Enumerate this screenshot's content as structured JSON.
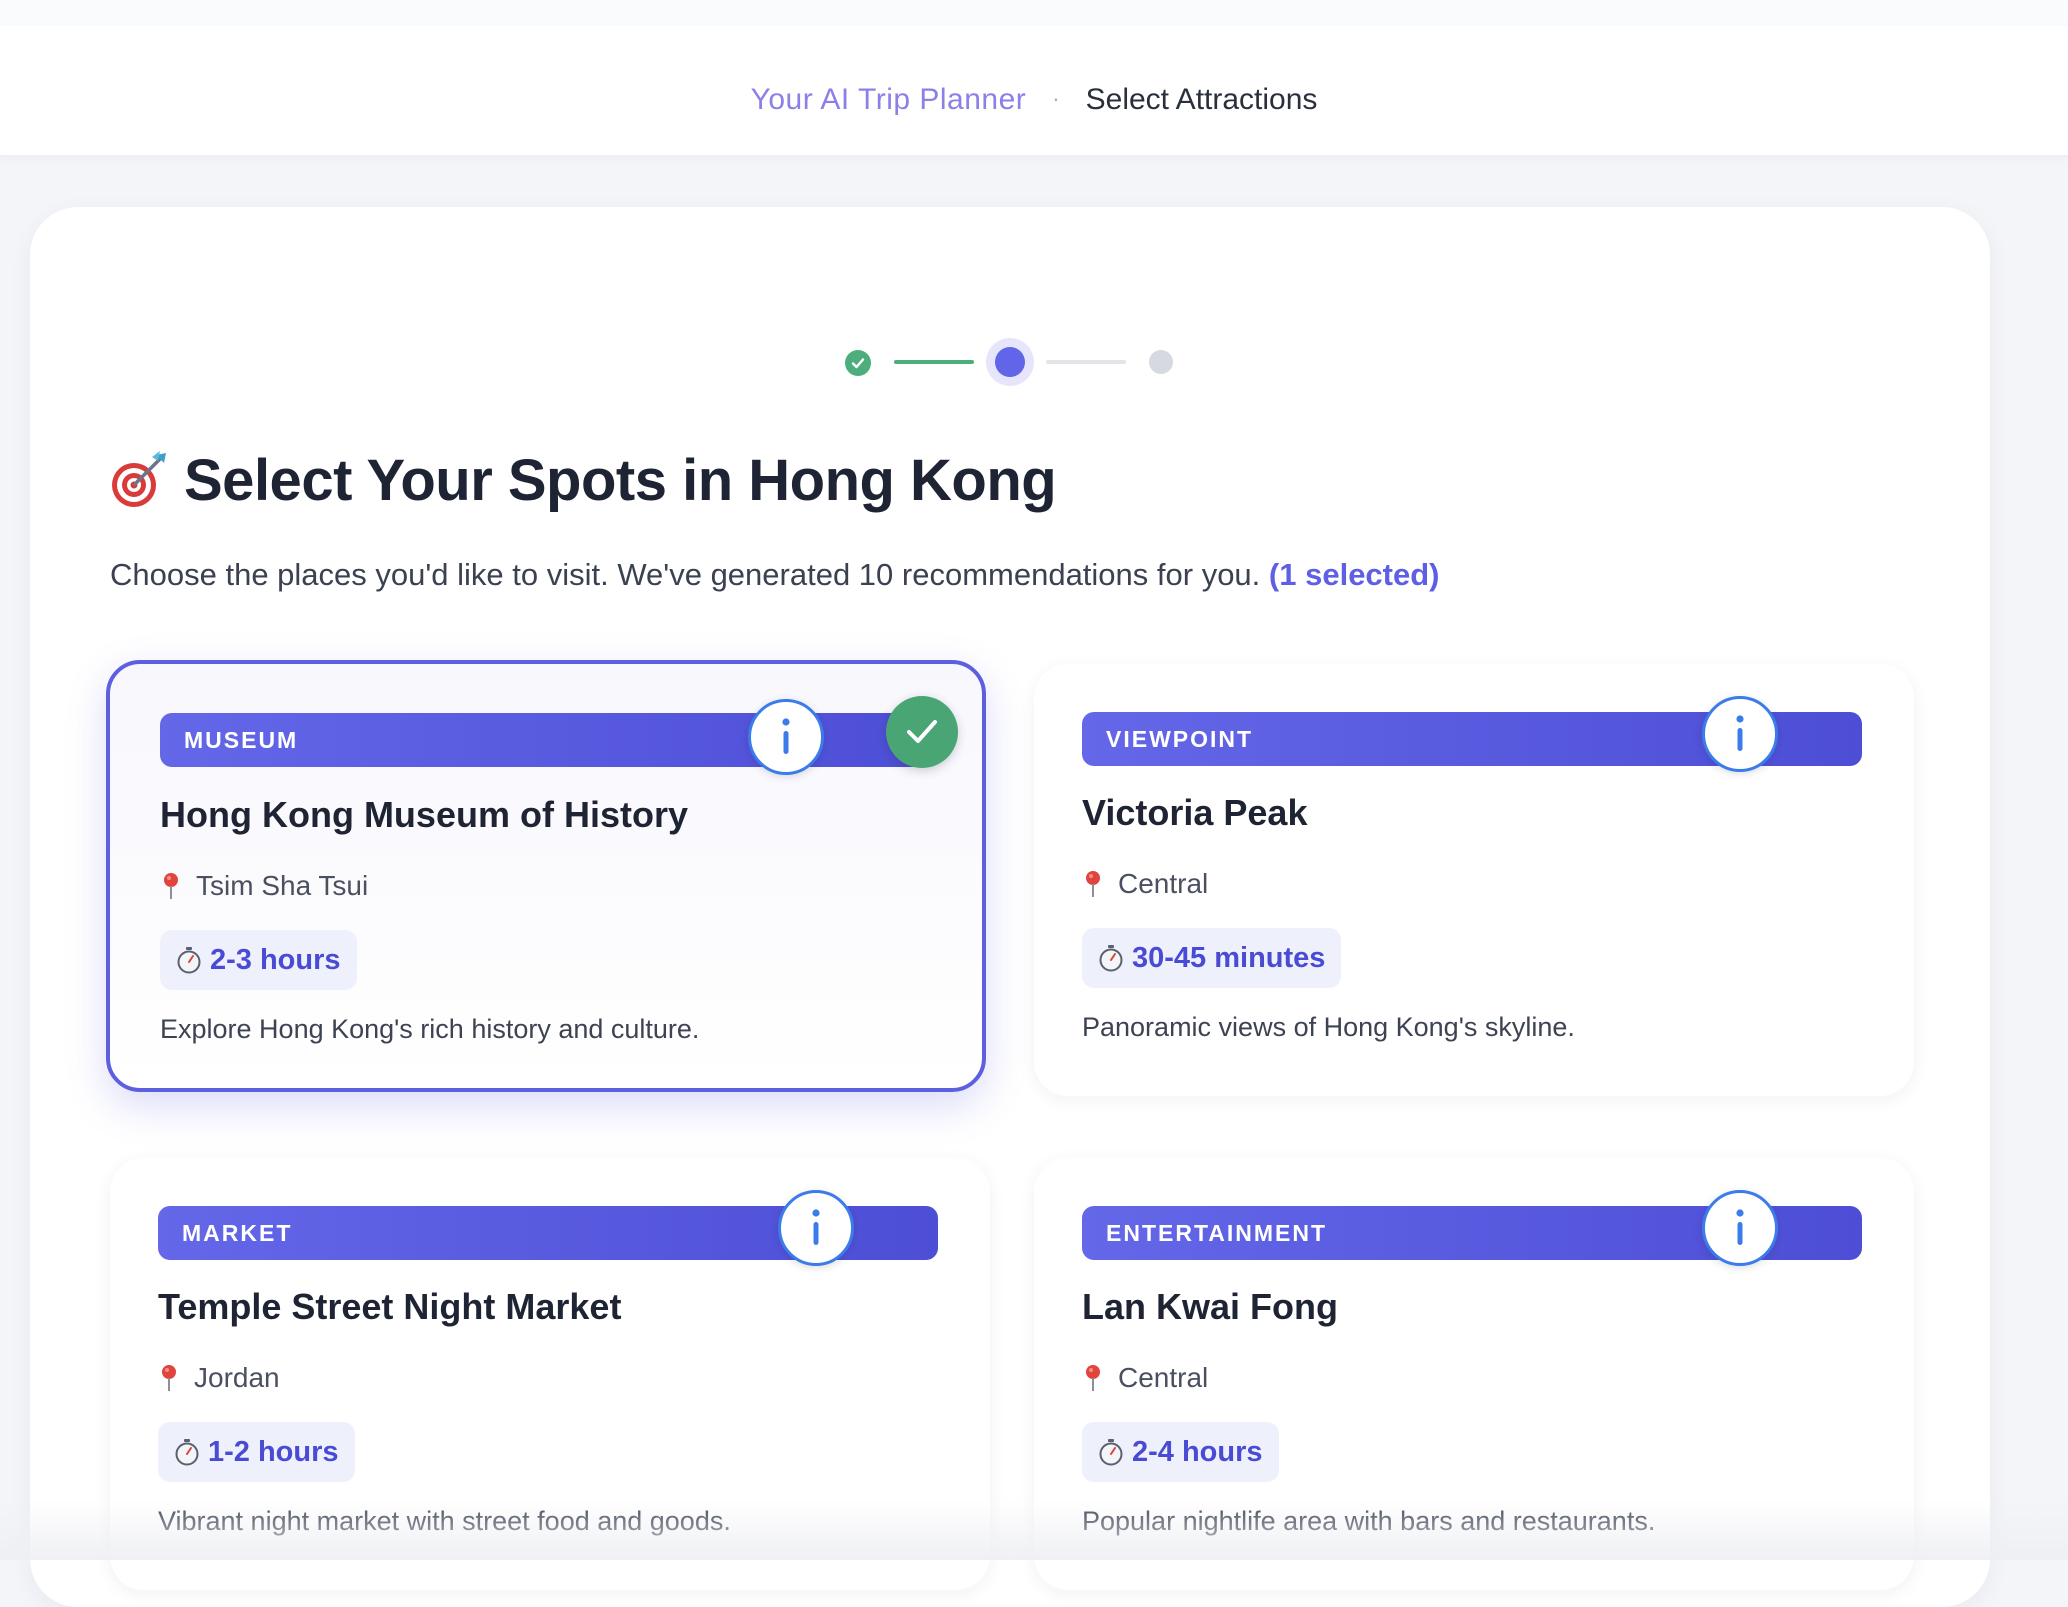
{
  "breadcrumb": {
    "home": "Your AI Trip Planner",
    "separator": "·",
    "current": "Select Attractions"
  },
  "stepper": {
    "steps": [
      {
        "state": "completed",
        "icon": "check-icon"
      },
      {
        "state": "current"
      },
      {
        "state": "upcoming"
      }
    ]
  },
  "page": {
    "title_icon": "dart-target-icon",
    "title": "Select Your Spots in Hong Kong",
    "subtitle": "Choose the places you'd like to visit. We've generated 10 recommendations for you.",
    "selected_count": "(1 selected)"
  },
  "cards": [
    {
      "category": "MUSEUM",
      "name": "Hong Kong Museum of History",
      "location": "Tsim Sha Tsui",
      "duration": "2-3 hours",
      "description": "Explore Hong Kong's rich history and culture.",
      "selected": true
    },
    {
      "category": "VIEWPOINT",
      "name": "Victoria Peak",
      "location": "Central",
      "duration": "30-45 minutes",
      "description": "Panoramic views of Hong Kong's skyline.",
      "selected": false
    },
    {
      "category": "MARKET",
      "name": "Temple Street Night Market",
      "location": "Jordan",
      "duration": "1-2 hours",
      "description": "Vibrant night market with street food and goods.",
      "selected": false
    },
    {
      "category": "ENTERTAINMENT",
      "name": "Lan Kwai Fong",
      "location": "Central",
      "duration": "2-4 hours",
      "description": "Popular nightlife area with bars and restaurants.",
      "selected": false
    }
  ],
  "colors": {
    "accent": "#5f5fe6",
    "category_bar_start": "#6467e8",
    "category_bar_end": "#4d4ed6",
    "success": "#4aa574",
    "info_border": "#3b7bea"
  }
}
